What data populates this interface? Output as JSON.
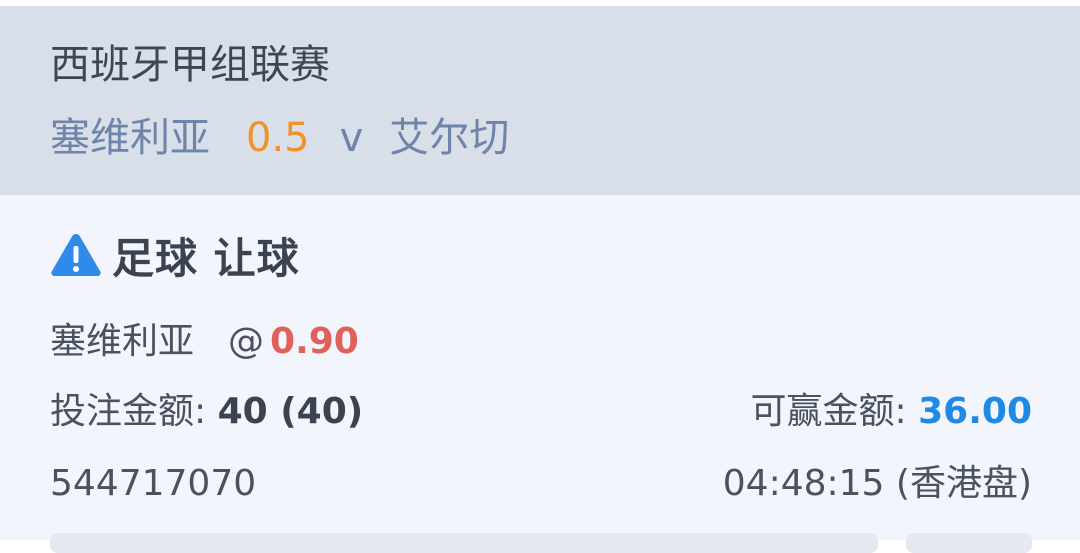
{
  "match": {
    "league": "西班牙甲组联赛",
    "home_team": "塞维利亚",
    "handicap": "0.5",
    "versus": "v",
    "away_team": "艾尔切"
  },
  "bet": {
    "title": "足球 让球",
    "warning_icon": "warning-triangle-icon",
    "selection": "塞维利亚",
    "at": "@",
    "odds": "0.90",
    "stake_label": "投注金额:",
    "stake_value": "40 (40)",
    "win_label": "可赢金额:",
    "win_value": "36.00",
    "bet_id": "544717070",
    "time": "04:48:15 (香港盘)"
  },
  "colors": {
    "header_bg": "#d9dfe9",
    "card_bg": "#f2f5fb",
    "team_blue": "#6f84a9",
    "handicap_orange": "#f0912c",
    "odds_red": "#e0605a",
    "win_blue": "#1e8ae6",
    "icon_blue": "#2f8ae8"
  }
}
